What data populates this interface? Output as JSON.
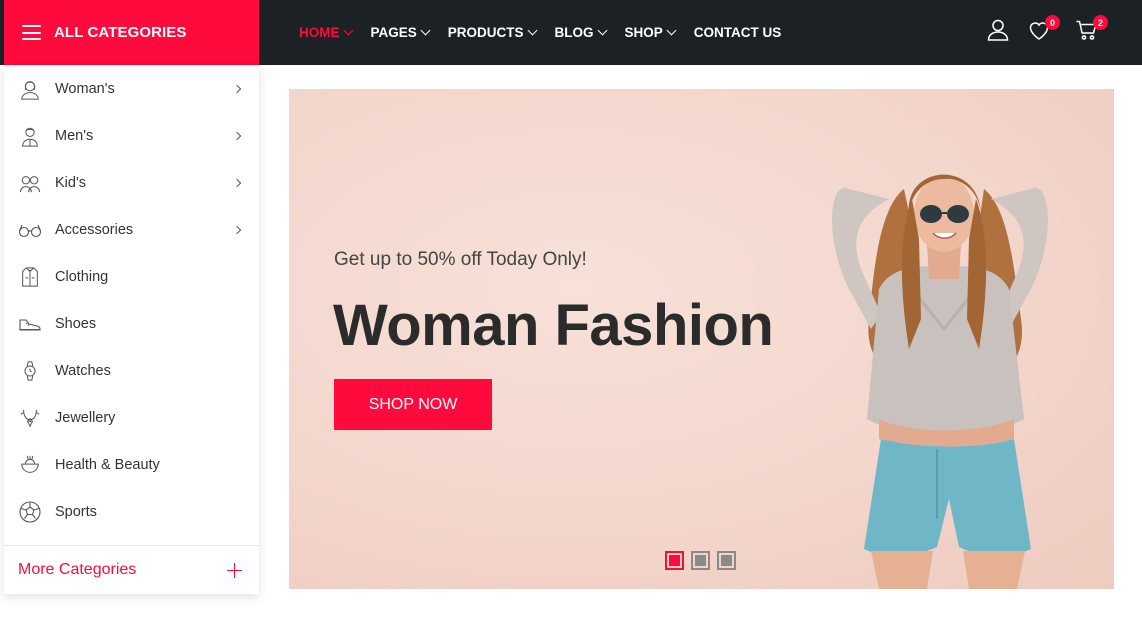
{
  "header": {
    "all_categories_label": "ALL CATEGORIES",
    "nav": [
      {
        "label": "HOME",
        "active": true,
        "dropdown": true
      },
      {
        "label": "PAGES",
        "active": false,
        "dropdown": true
      },
      {
        "label": "PRODUCTS",
        "active": false,
        "dropdown": true
      },
      {
        "label": "BLOG",
        "active": false,
        "dropdown": true
      },
      {
        "label": "SHOP",
        "active": false,
        "dropdown": true
      },
      {
        "label": "CONTACT US",
        "active": false,
        "dropdown": false
      }
    ],
    "wishlist_count": "0",
    "cart_count": "2",
    "icons": [
      "user-icon",
      "heart-icon",
      "cart-icon"
    ]
  },
  "sidebar": {
    "items": [
      {
        "label": "Woman's",
        "icon": "woman-icon",
        "has_submenu": true
      },
      {
        "label": "Men's",
        "icon": "man-icon",
        "has_submenu": true
      },
      {
        "label": "Kid's",
        "icon": "kids-icon",
        "has_submenu": true
      },
      {
        "label": "Accessories",
        "icon": "glasses-icon",
        "has_submenu": true
      },
      {
        "label": "Clothing",
        "icon": "jacket-icon",
        "has_submenu": false
      },
      {
        "label": "Shoes",
        "icon": "shoe-icon",
        "has_submenu": false
      },
      {
        "label": "Watches",
        "icon": "watch-icon",
        "has_submenu": false
      },
      {
        "label": "Jewellery",
        "icon": "jewellery-icon",
        "has_submenu": false
      },
      {
        "label": "Health & Beauty",
        "icon": "beauty-icon",
        "has_submenu": false
      },
      {
        "label": "Sports",
        "icon": "ball-icon",
        "has_submenu": false
      }
    ],
    "more_label": "More Categories"
  },
  "hero": {
    "subtitle": "Get up to 50% off Today Only!",
    "title": "Woman Fashion",
    "cta_label": "SHOP NOW",
    "slides": 3,
    "active_slide": 1
  },
  "colors": {
    "accent": "#ff0a3c",
    "topbar": "#1b2124",
    "hero_bg": "#f3d6cc"
  }
}
